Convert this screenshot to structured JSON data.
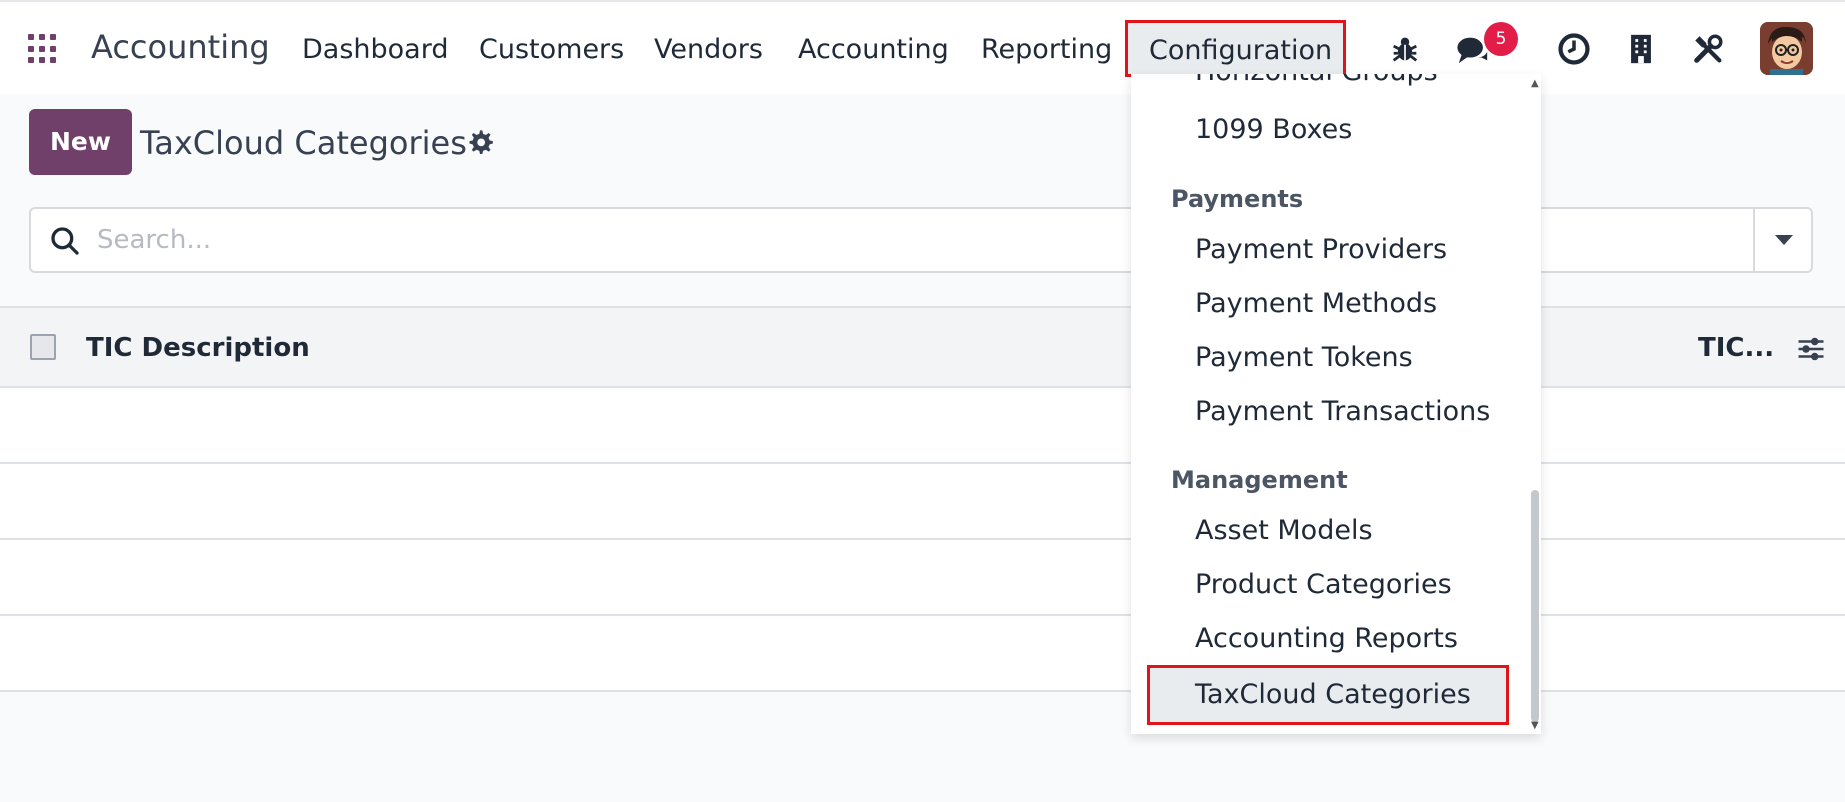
{
  "app": {
    "name": "Accounting"
  },
  "nav": {
    "items": [
      "Dashboard",
      "Customers",
      "Vendors",
      "Accounting",
      "Reporting"
    ],
    "active": "Configuration"
  },
  "systray": {
    "messages_count": "5"
  },
  "control": {
    "new_label": "New",
    "title": "TaxCloud Categories"
  },
  "search": {
    "placeholder": "Search..."
  },
  "list": {
    "columns": [
      "TIC Description",
      "TIC..."
    ]
  },
  "dropdown": {
    "cut_item": "Horizontal Groups",
    "items_top": [
      "1099 Boxes"
    ],
    "sections": [
      {
        "title": "Payments",
        "items": [
          "Payment Providers",
          "Payment Methods",
          "Payment Tokens",
          "Payment Transactions"
        ]
      },
      {
        "title": "Management",
        "items": [
          "Asset Models",
          "Product Categories",
          "Accounting Reports"
        ]
      }
    ],
    "active_item": "TaxCloud Categories"
  },
  "colors": {
    "brand": "#71406a",
    "highlight": "#e1141b",
    "badge": "#e11d48"
  }
}
